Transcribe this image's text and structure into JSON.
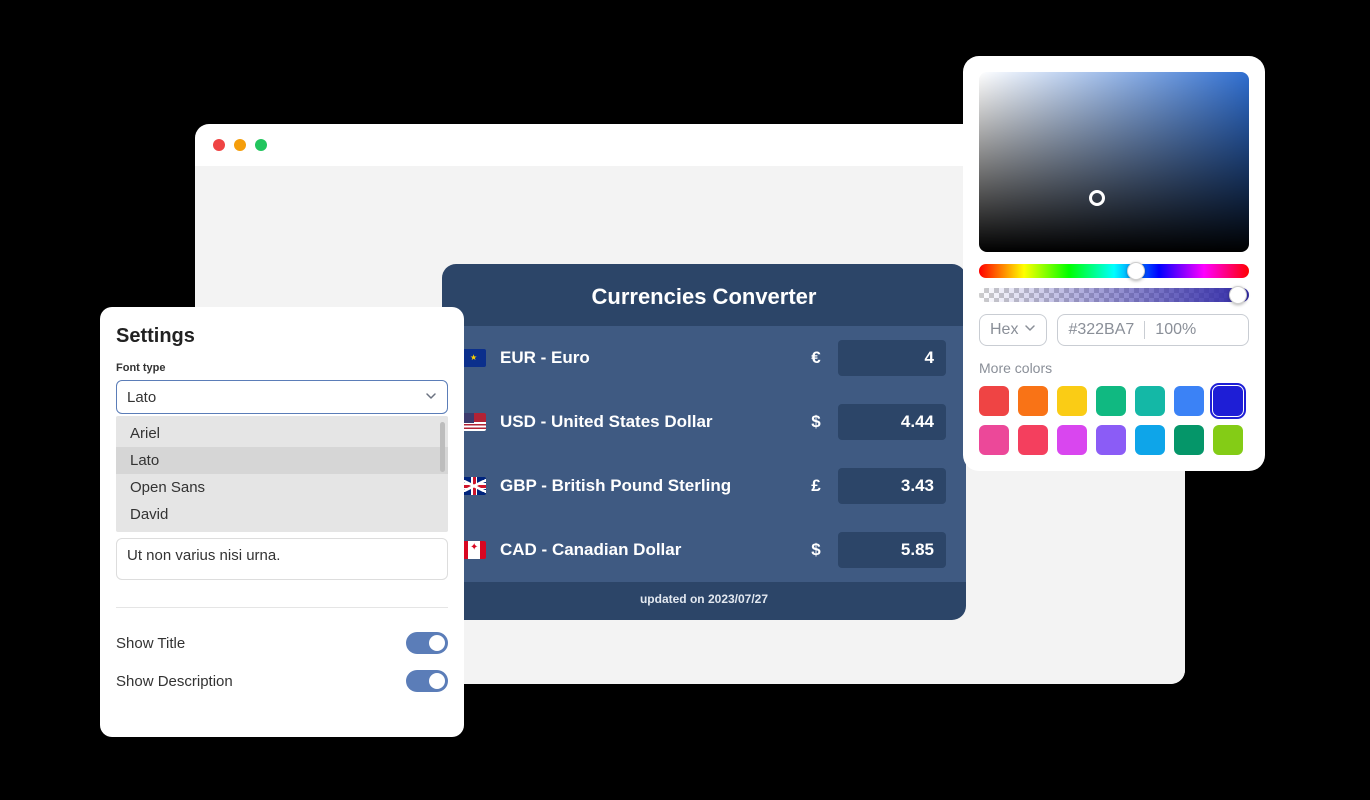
{
  "browser": {
    "dots": [
      "close",
      "minimize",
      "maximize"
    ]
  },
  "currencies": {
    "title": "Currencies Converter",
    "rows": [
      {
        "code": "EUR",
        "label": "EUR - Euro",
        "symbol": "€",
        "value": "4",
        "flag": "eu"
      },
      {
        "code": "USD",
        "label": "USD - United States Dollar",
        "symbol": "$",
        "value": "4.44",
        "flag": "us"
      },
      {
        "code": "GBP",
        "label": "GBP - British Pound Sterling",
        "symbol": "£",
        "value": "3.43",
        "flag": "gb"
      },
      {
        "code": "CAD",
        "label": "CAD - Canadian Dollar",
        "symbol": "$",
        "value": "5.85",
        "flag": "ca"
      }
    ],
    "updated_prefix": "updated on ",
    "updated_date": "2023/07/27"
  },
  "settings": {
    "title": "Settings",
    "font_type_label": "Font type",
    "font_selected": "Lato",
    "font_options": [
      "Ariel",
      "Lato",
      "Open Sans",
      "David"
    ],
    "textarea_value": "Ut non varius nisi urna.",
    "show_title_label": "Show Title",
    "show_title_value": true,
    "show_description_label": "Show Description",
    "show_description_value": true
  },
  "picker": {
    "format_label": "Hex",
    "hex_value": "#322BA7",
    "opacity_value": "100%",
    "more_label": "More colors",
    "hue_position_pct": 58,
    "alpha_position_pct": 96,
    "swatches": [
      {
        "color": "#ef4444"
      },
      {
        "color": "#f97316"
      },
      {
        "color": "#facc15"
      },
      {
        "color": "#10b981"
      },
      {
        "color": "#14b8a6"
      },
      {
        "color": "#3b82f6"
      },
      {
        "color": "#1e1ed6",
        "selected": true
      },
      {
        "color": "#ec4899"
      },
      {
        "color": "#f43f5e"
      },
      {
        "color": "#d946ef"
      },
      {
        "color": "#8b5cf6"
      },
      {
        "color": "#0ea5e9"
      },
      {
        "color": "#059669"
      },
      {
        "color": "#84cc16"
      }
    ]
  }
}
